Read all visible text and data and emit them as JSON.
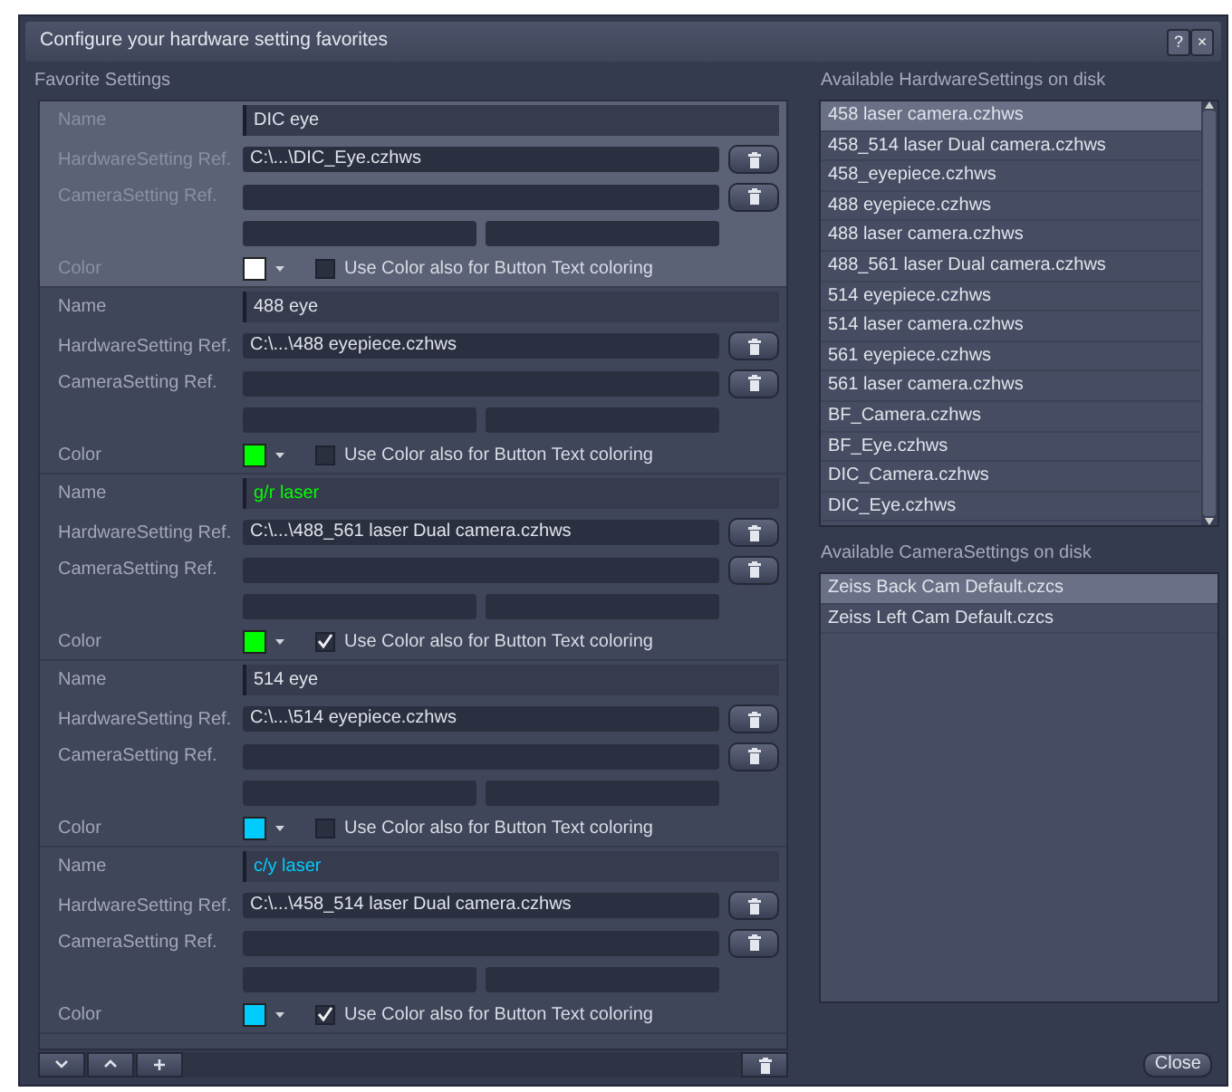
{
  "window": {
    "title": "Configure your hardware setting favorites",
    "buttons": [
      "?",
      "×"
    ]
  },
  "favorites": {
    "heading": "Favorite Settings",
    "items": [
      {
        "selected": true,
        "name_label": "Name",
        "name": "DIC eye",
        "hw_label": "HardwareSetting Ref.",
        "hw_ref": "C:\\...\\DIC_Eye.czhws",
        "cam_label": "CameraSetting Ref.",
        "color_label": "Color",
        "color": "#ffffff",
        "use_color": false,
        "use_color_label": "Use Color also for Button Text coloring"
      },
      {
        "selected": false,
        "name_label": "Name",
        "name": "488 eye",
        "hw_label": "HardwareSetting Ref.",
        "hw_ref": "C:\\...\\488 eyepiece.czhws",
        "cam_label": "CameraSetting Ref.",
        "color_label": "Color",
        "color": "#00ff00",
        "use_color": false,
        "use_color_label": "Use Color also for Button Text coloring"
      },
      {
        "selected": false,
        "name_label": "Name",
        "name": "g/r laser",
        "hw_label": "HardwareSetting Ref.",
        "hw_ref": "C:\\...\\488_561 laser Dual camera.czhws",
        "cam_label": "CameraSetting Ref.",
        "color_label": "Color",
        "color": "#00ff00",
        "use_color": true,
        "use_color_label": "Use Color also for Button Text coloring"
      },
      {
        "selected": false,
        "name_label": "Name",
        "name": "514 eye",
        "hw_label": "HardwareSetting Ref.",
        "hw_ref": "C:\\...\\514 eyepiece.czhws",
        "cam_label": "CameraSetting Ref.",
        "color_label": "Color",
        "color": "#00ccff",
        "use_color": false,
        "use_color_label": "Use Color also for Button Text coloring"
      },
      {
        "selected": false,
        "name_label": "Name",
        "name": "c/y laser",
        "hw_label": "HardwareSetting Ref.",
        "hw_ref": "C:\\...\\458_514 laser Dual camera.czhws",
        "cam_label": "CameraSetting Ref.",
        "color_label": "Color",
        "color": "#00ccff",
        "use_color": true,
        "use_color_label": "Use Color also for Button Text coloring"
      }
    ]
  },
  "hardware_settings": {
    "heading": "Available HardwareSettings on disk",
    "items": [
      {
        "label": "458 laser camera.czhws",
        "selected": true
      },
      {
        "label": "458_514 laser Dual camera.czhws",
        "selected": false
      },
      {
        "label": "458_eyepiece.czhws",
        "selected": false
      },
      {
        "label": "488 eyepiece.czhws",
        "selected": false
      },
      {
        "label": "488 laser camera.czhws",
        "selected": false
      },
      {
        "label": "488_561 laser Dual camera.czhws",
        "selected": false
      },
      {
        "label": "514 eyepiece.czhws",
        "selected": false
      },
      {
        "label": "514 laser camera.czhws",
        "selected": false
      },
      {
        "label": "561 eyepiece.czhws",
        "selected": false
      },
      {
        "label": "561 laser camera.czhws",
        "selected": false
      },
      {
        "label": "BF_Camera.czhws",
        "selected": false
      },
      {
        "label": "BF_Eye.czhws",
        "selected": false
      },
      {
        "label": "DIC_Camera.czhws",
        "selected": false
      },
      {
        "label": "DIC_Eye.czhws",
        "selected": false
      }
    ]
  },
  "camera_settings": {
    "heading": "Available CameraSettings on disk",
    "items": [
      {
        "label": "Zeiss Back Cam Default.czcs",
        "selected": true
      },
      {
        "label": "Zeiss Left Cam Default.czcs",
        "selected": false
      }
    ]
  },
  "close_button": "Close"
}
